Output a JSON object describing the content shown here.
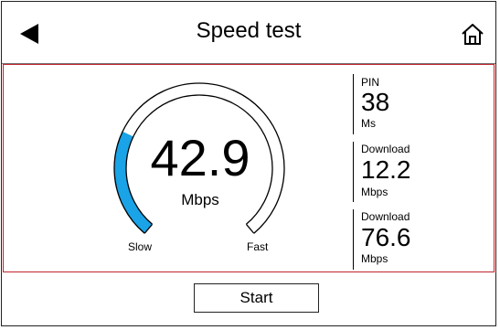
{
  "header": {
    "title": "Speed test",
    "back_icon": "back-arrow-icon",
    "home_icon": "home-icon"
  },
  "gauge": {
    "value": "42.9",
    "unit": "Mbps",
    "min_label": "Slow",
    "max_label": "Fast",
    "fill_fraction": 0.27,
    "fill_color": "#1aa3e6",
    "ring_color": "#000000"
  },
  "stats": [
    {
      "label": "PIN",
      "value": "38",
      "unit": "Ms"
    },
    {
      "label": "Download",
      "value": "12.2",
      "unit": "Mbps"
    },
    {
      "label": "Download",
      "value": "76.6",
      "unit": "Mbps"
    }
  ],
  "actions": {
    "start_label": "Start"
  },
  "colors": {
    "accent": "#1aa3e6",
    "content_border": "#c0262b"
  }
}
